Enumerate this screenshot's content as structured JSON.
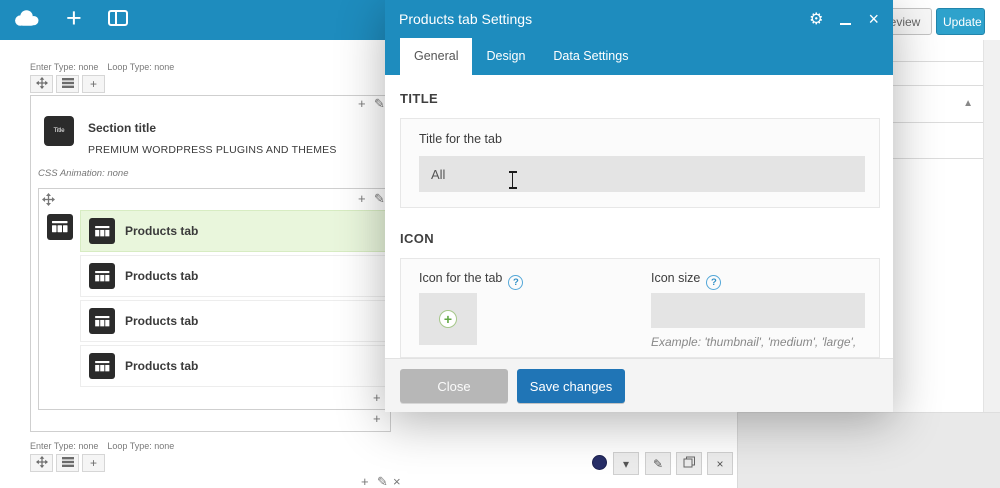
{
  "colors": {
    "topbar_blue": "#1e8cbe",
    "update_blue": "#2ea2cc",
    "save_blue": "#2075b6",
    "active_row_green": "#e9f6dc",
    "navy_indicator": "#272e67"
  },
  "topbar": {
    "preview_label": "Preview",
    "update_label": "Update"
  },
  "modal": {
    "title": "Products tab Settings",
    "tabs": [
      {
        "label": "General",
        "active": true
      },
      {
        "label": "Design",
        "active": false
      },
      {
        "label": "Data Settings",
        "active": false
      }
    ],
    "title_section": {
      "heading": "TITLE",
      "field_label": "Title for the tab",
      "field_value": "All"
    },
    "icon_section": {
      "heading": "ICON",
      "icon_label": "Icon for the tab",
      "size_label": "Icon size",
      "size_value": "",
      "size_hint": "Example: 'thumbnail', 'medium', 'large',"
    },
    "footer": {
      "close_label": "Close",
      "save_label": "Save changes"
    }
  },
  "canvas": {
    "meta": {
      "entry": "Enter Type: none",
      "loop": "Loop Type: none"
    },
    "section_title": {
      "icon_text": "Title",
      "name": "Section title",
      "subtitle": "PREMIUM WORDPRESS PLUGINS AND THEMES",
      "css_animation": "CSS Animation: none"
    },
    "tab_rows": [
      {
        "label": "Products tab",
        "active": true
      },
      {
        "label": "Products tab",
        "active": false
      },
      {
        "label": "Products tab",
        "active": false
      },
      {
        "label": "Products tab",
        "active": false
      }
    ]
  },
  "icons": {
    "gear": "⚙",
    "close": "×",
    "pencil": "✎",
    "plus": "+",
    "caret_down": "▾",
    "collapse_up": "▲",
    "help": "?"
  }
}
